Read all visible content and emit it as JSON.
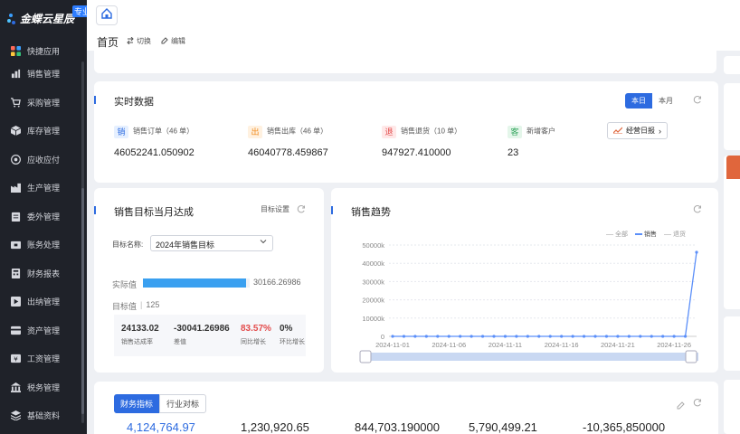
{
  "logo": {
    "brand": "金蝶云星辰",
    "badge": "专业版"
  },
  "sidebar": {
    "items": [
      {
        "label": "快捷应用",
        "icon": "grid-icon"
      },
      {
        "label": "销售管理",
        "icon": "chart-icon"
      },
      {
        "label": "采购管理",
        "icon": "cart-icon"
      },
      {
        "label": "库存管理",
        "icon": "box-icon"
      },
      {
        "label": "应收应付",
        "icon": "coin-icon"
      },
      {
        "label": "生产管理",
        "icon": "factory-icon"
      },
      {
        "label": "委外管理",
        "icon": "clipboard-icon"
      },
      {
        "label": "账务处理",
        "icon": "ledger-icon"
      },
      {
        "label": "财务报表",
        "icon": "calculator-icon"
      },
      {
        "label": "出纳管理",
        "icon": "cashier-icon"
      },
      {
        "label": "资产管理",
        "icon": "asset-icon"
      },
      {
        "label": "工资管理",
        "icon": "payroll-icon"
      },
      {
        "label": "税务管理",
        "icon": "tax-icon"
      },
      {
        "label": "基础资料",
        "icon": "layers-icon"
      }
    ]
  },
  "topbar": {
    "page_title": "首页",
    "switch_label": "切换",
    "edit_label": "编辑"
  },
  "realtime": {
    "title": "实时数据",
    "toggle": [
      "本日",
      "本月"
    ],
    "cells": [
      {
        "tag": "销",
        "label": "销售订单（46 单）",
        "value": "46052241.050902",
        "tag_bg": "#e6f0ff",
        "tag_color": "#2d6be0"
      },
      {
        "tag": "出",
        "label": "销售出库（46 单）",
        "value": "46040778.459867",
        "tag_bg": "#fff1e0",
        "tag_color": "#f08a1c"
      },
      {
        "tag": "退",
        "label": "销售退货（10 单）",
        "value": "947927.410000",
        "tag_bg": "#ffe8e8",
        "tag_color": "#e34c4c"
      },
      {
        "tag": "客",
        "label": "新增客户",
        "value": "23",
        "tag_bg": "#e4f6ea",
        "tag_color": "#2fa35a"
      }
    ],
    "report_button": "经营日报"
  },
  "target": {
    "title": "销售目标当月达成",
    "settings": "目标设置",
    "name_label": "目标名称:",
    "selected": "2024年销售目标",
    "actual_label": "实际值",
    "actual_value": "30166.26986",
    "actual_fraction": 0.97,
    "target_label": "目标值",
    "target_value": "125",
    "kpis": [
      {
        "value": "24133.02",
        "label": "销售达成率",
        "color": "#222"
      },
      {
        "value": "-30041.26986",
        "label": "差值",
        "color": "#222"
      },
      {
        "value": "83.57%",
        "label": "同比增长",
        "color": "#e34c4c"
      },
      {
        "value": "0%",
        "label": "环比增长",
        "color": "#222"
      }
    ]
  },
  "trend": {
    "title": "销售趋势",
    "legend": [
      "全部",
      "销售",
      "退货"
    ]
  },
  "chart_data": {
    "type": "line",
    "x_ticks": [
      "2024-11-01",
      "2024-11-06",
      "2024-11-11",
      "2024-11-16",
      "2024-11-21",
      "2024-11-26"
    ],
    "y_ticks": [
      "50000k",
      "40000k",
      "30000k",
      "20000k",
      "10000k",
      "0"
    ],
    "ylim": [
      0,
      50000
    ],
    "series": [
      {
        "name": "销售",
        "x": [
          "2024-11-01",
          "2024-11-02",
          "2024-11-03",
          "2024-11-04",
          "2024-11-05",
          "2024-11-06",
          "2024-11-07",
          "2024-11-08",
          "2024-11-09",
          "2024-11-10",
          "2024-11-11",
          "2024-11-12",
          "2024-11-13",
          "2024-11-14",
          "2024-11-15",
          "2024-11-16",
          "2024-11-17",
          "2024-11-18",
          "2024-11-19",
          "2024-11-20",
          "2024-11-21",
          "2024-11-22",
          "2024-11-23",
          "2024-11-24",
          "2024-11-25",
          "2024-11-26",
          "2024-11-27",
          "2024-11-28"
        ],
        "values": [
          0,
          0,
          0,
          0,
          0,
          0,
          0,
          0,
          0,
          0,
          0,
          0,
          0,
          0,
          0,
          0,
          0,
          0,
          0,
          0,
          0,
          0,
          0,
          0,
          0,
          0,
          0,
          46052
        ]
      }
    ],
    "grid": true
  },
  "finance": {
    "tabs": [
      "财务指标",
      "行业对标"
    ],
    "values": [
      "4,124,764.97",
      "1,230,920.65",
      "844,703.190000",
      "5,790,499.21",
      "-10,365,850000"
    ]
  }
}
